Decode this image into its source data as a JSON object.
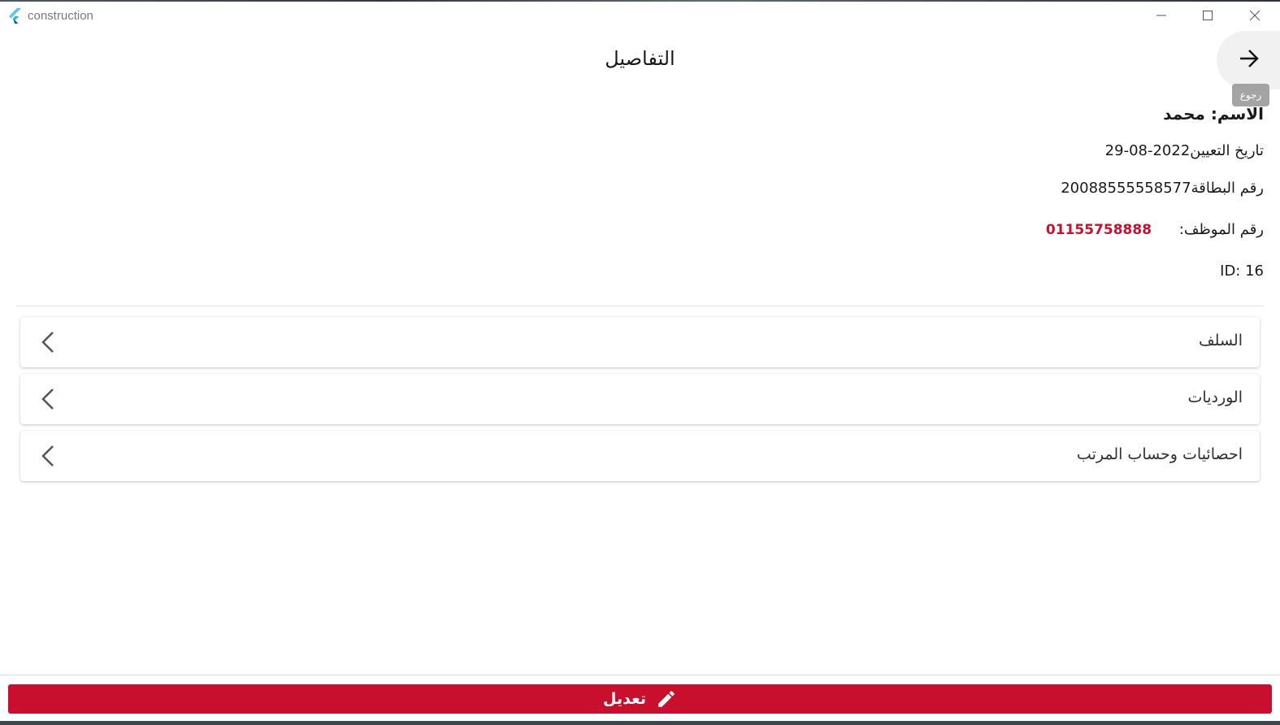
{
  "window": {
    "app_title": "construction",
    "controls": [
      "minimize",
      "maximize",
      "close"
    ]
  },
  "header": {
    "title": "التفاصيل",
    "back_tooltip": "رجوع",
    "back_icon": "arrow-right-icon"
  },
  "details": {
    "name_line": "الاسم: محمد",
    "hire_date_line": "تاريخ التعيين2022-08-29",
    "card_line": "رقم البطاقة20088555558577",
    "employee_label": "رقم الموظف:",
    "employee_phone": "01155758888",
    "id_line": "ID: 16"
  },
  "sections": [
    {
      "label": "السلف",
      "icon": "chevron-left-icon"
    },
    {
      "label": "الورديات",
      "icon": "chevron-left-icon"
    },
    {
      "label": "احصائيات وحساب المرتب",
      "icon": "chevron-left-icon"
    }
  ],
  "footer": {
    "edit_label": "تعديل",
    "edit_icon": "pencil-icon"
  },
  "colors": {
    "accent": "#c8102e",
    "phone": "#c8102e",
    "background": "#ffffff"
  }
}
